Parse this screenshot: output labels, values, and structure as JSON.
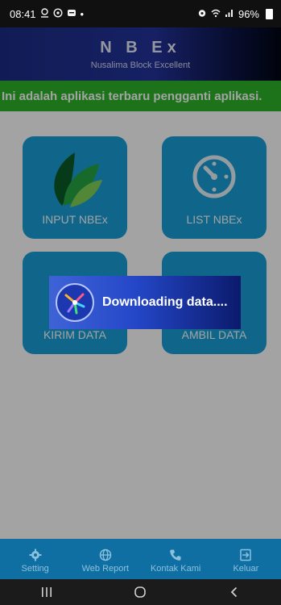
{
  "status": {
    "time": "08:41",
    "dot": "•",
    "battery": "96%",
    "left_icons": [
      "location-icon",
      "whatsapp-icon",
      "message-icon"
    ],
    "right_icons": [
      "alarm-icon",
      "wifi-icon",
      "signal-icon",
      "battery-icon"
    ]
  },
  "header": {
    "title": "N B Ex",
    "subtitle": "Nusalima Block Excellent"
  },
  "marquee": {
    "text": "Ini adalah aplikasi terbaru pengganti aplikasi."
  },
  "tiles": [
    {
      "label": "INPUT NBEx",
      "icon": "leaf-icon"
    },
    {
      "label": "LIST NBEx",
      "icon": "timer-icon"
    },
    {
      "label": "KIRIM DATA",
      "icon": "upload-icon"
    },
    {
      "label": "AMBIL DATA",
      "icon": "download-icon"
    }
  ],
  "dialog": {
    "message": "Downloading data...."
  },
  "bottom_nav": [
    {
      "label": "Setting",
      "icon": "gear-icon"
    },
    {
      "label": "Web Report",
      "icon": "globe-icon"
    },
    {
      "label": "Kontak Kami",
      "icon": "phone-icon"
    },
    {
      "label": "Keluar",
      "icon": "logout-icon"
    }
  ],
  "colors": {
    "tile": "#1aa0d8",
    "marquee": "#2eb52a",
    "header_start": "#1c2d86",
    "nav": "#0f6fa3"
  }
}
